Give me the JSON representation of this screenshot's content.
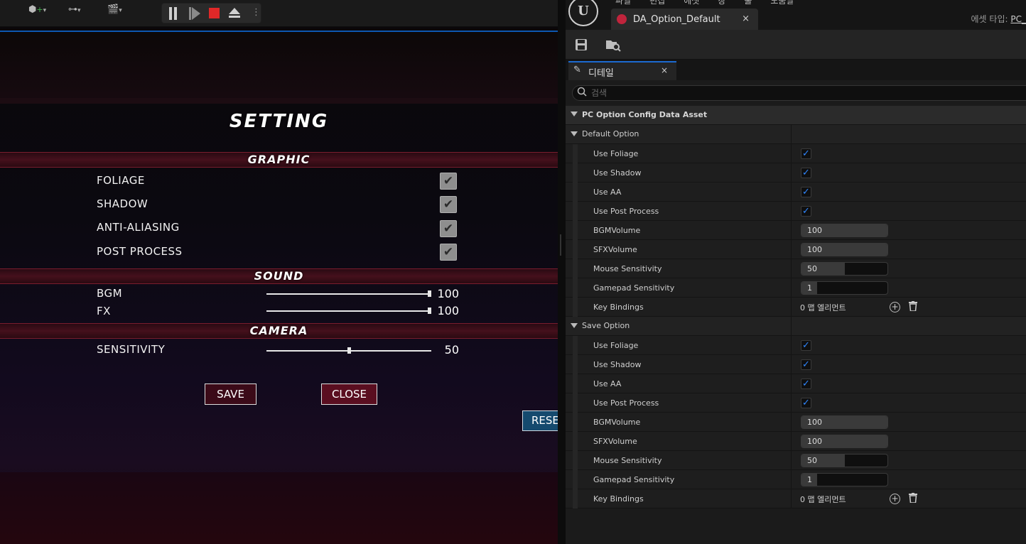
{
  "game_ui": {
    "title": "Setting",
    "sections": {
      "graphic": "Graphic",
      "sound": "Sound",
      "camera": "Camera"
    },
    "options": {
      "foliage": {
        "label": "Foliage",
        "checked": true
      },
      "shadow": {
        "label": "Shadow",
        "checked": true
      },
      "anti_aliasing": {
        "label": "Anti-Aliasing",
        "checked": true
      },
      "post_process": {
        "label": "Post Process",
        "checked": true
      }
    },
    "sliders": {
      "bgm": {
        "label": "BGM",
        "value": "100",
        "fraction": 1.0
      },
      "fx": {
        "label": "FX",
        "value": "100",
        "fraction": 1.0
      },
      "sensitivity": {
        "label": "Sensitivity",
        "value": "50",
        "fraction": 0.5
      }
    },
    "buttons": {
      "save": "Save",
      "close": "Close",
      "reset": "Rese"
    },
    "check_glyph": "✔"
  },
  "editor": {
    "logo_text": "U",
    "menu": [
      "파일",
      "편집",
      "에셋",
      "창",
      "툴",
      "도움말"
    ],
    "asset_tab": {
      "name": "DA_Option_Default",
      "close": "×"
    },
    "asset_type": {
      "label": "에셋 타입:",
      "value": "PC_"
    },
    "toolbar_icons": [
      "save-icon",
      "browse-icon"
    ],
    "details_tab": {
      "label": "디테일",
      "close": "×"
    },
    "search": {
      "placeholder": "검색",
      "value": ""
    },
    "category": "PC Option Config Data Asset",
    "groups": [
      {
        "label": "Default Option",
        "props": [
          {
            "name": "Use Foliage",
            "type": "check",
            "checked": true
          },
          {
            "name": "Use Shadow",
            "type": "check",
            "checked": true
          },
          {
            "name": "Use AA",
            "type": "check",
            "checked": true
          },
          {
            "name": "Use Post Process",
            "type": "check",
            "checked": true
          },
          {
            "name": "BGMVolume",
            "type": "number",
            "value": "100",
            "fill": 1.0
          },
          {
            "name": "SFXVolume",
            "type": "number",
            "value": "100",
            "fill": 1.0
          },
          {
            "name": "Mouse Sensitivity",
            "type": "number",
            "value": "50",
            "fill": 0.5
          },
          {
            "name": "Gamepad Sensitivity",
            "type": "number",
            "value": "1",
            "fill": 0.18
          },
          {
            "name": "Key Bindings",
            "type": "map",
            "value": "0 맵 엘리먼트"
          }
        ]
      },
      {
        "label": "Save Option",
        "props": [
          {
            "name": "Use Foliage",
            "type": "check",
            "checked": true
          },
          {
            "name": "Use Shadow",
            "type": "check",
            "checked": true
          },
          {
            "name": "Use AA",
            "type": "check",
            "checked": true
          },
          {
            "name": "Use Post Process",
            "type": "check",
            "checked": true
          },
          {
            "name": "BGMVolume",
            "type": "number",
            "value": "100",
            "fill": 1.0
          },
          {
            "name": "SFXVolume",
            "type": "number",
            "value": "100",
            "fill": 1.0
          },
          {
            "name": "Mouse Sensitivity",
            "type": "number",
            "value": "50",
            "fill": 0.5
          },
          {
            "name": "Gamepad Sensitivity",
            "type": "number",
            "value": "1",
            "fill": 0.18
          },
          {
            "name": "Key Bindings",
            "type": "map",
            "value": "0 맵 엘리먼트"
          }
        ]
      }
    ],
    "check_glyph": "✓",
    "add_glyph": "+",
    "delete_glyph": "🗑"
  }
}
